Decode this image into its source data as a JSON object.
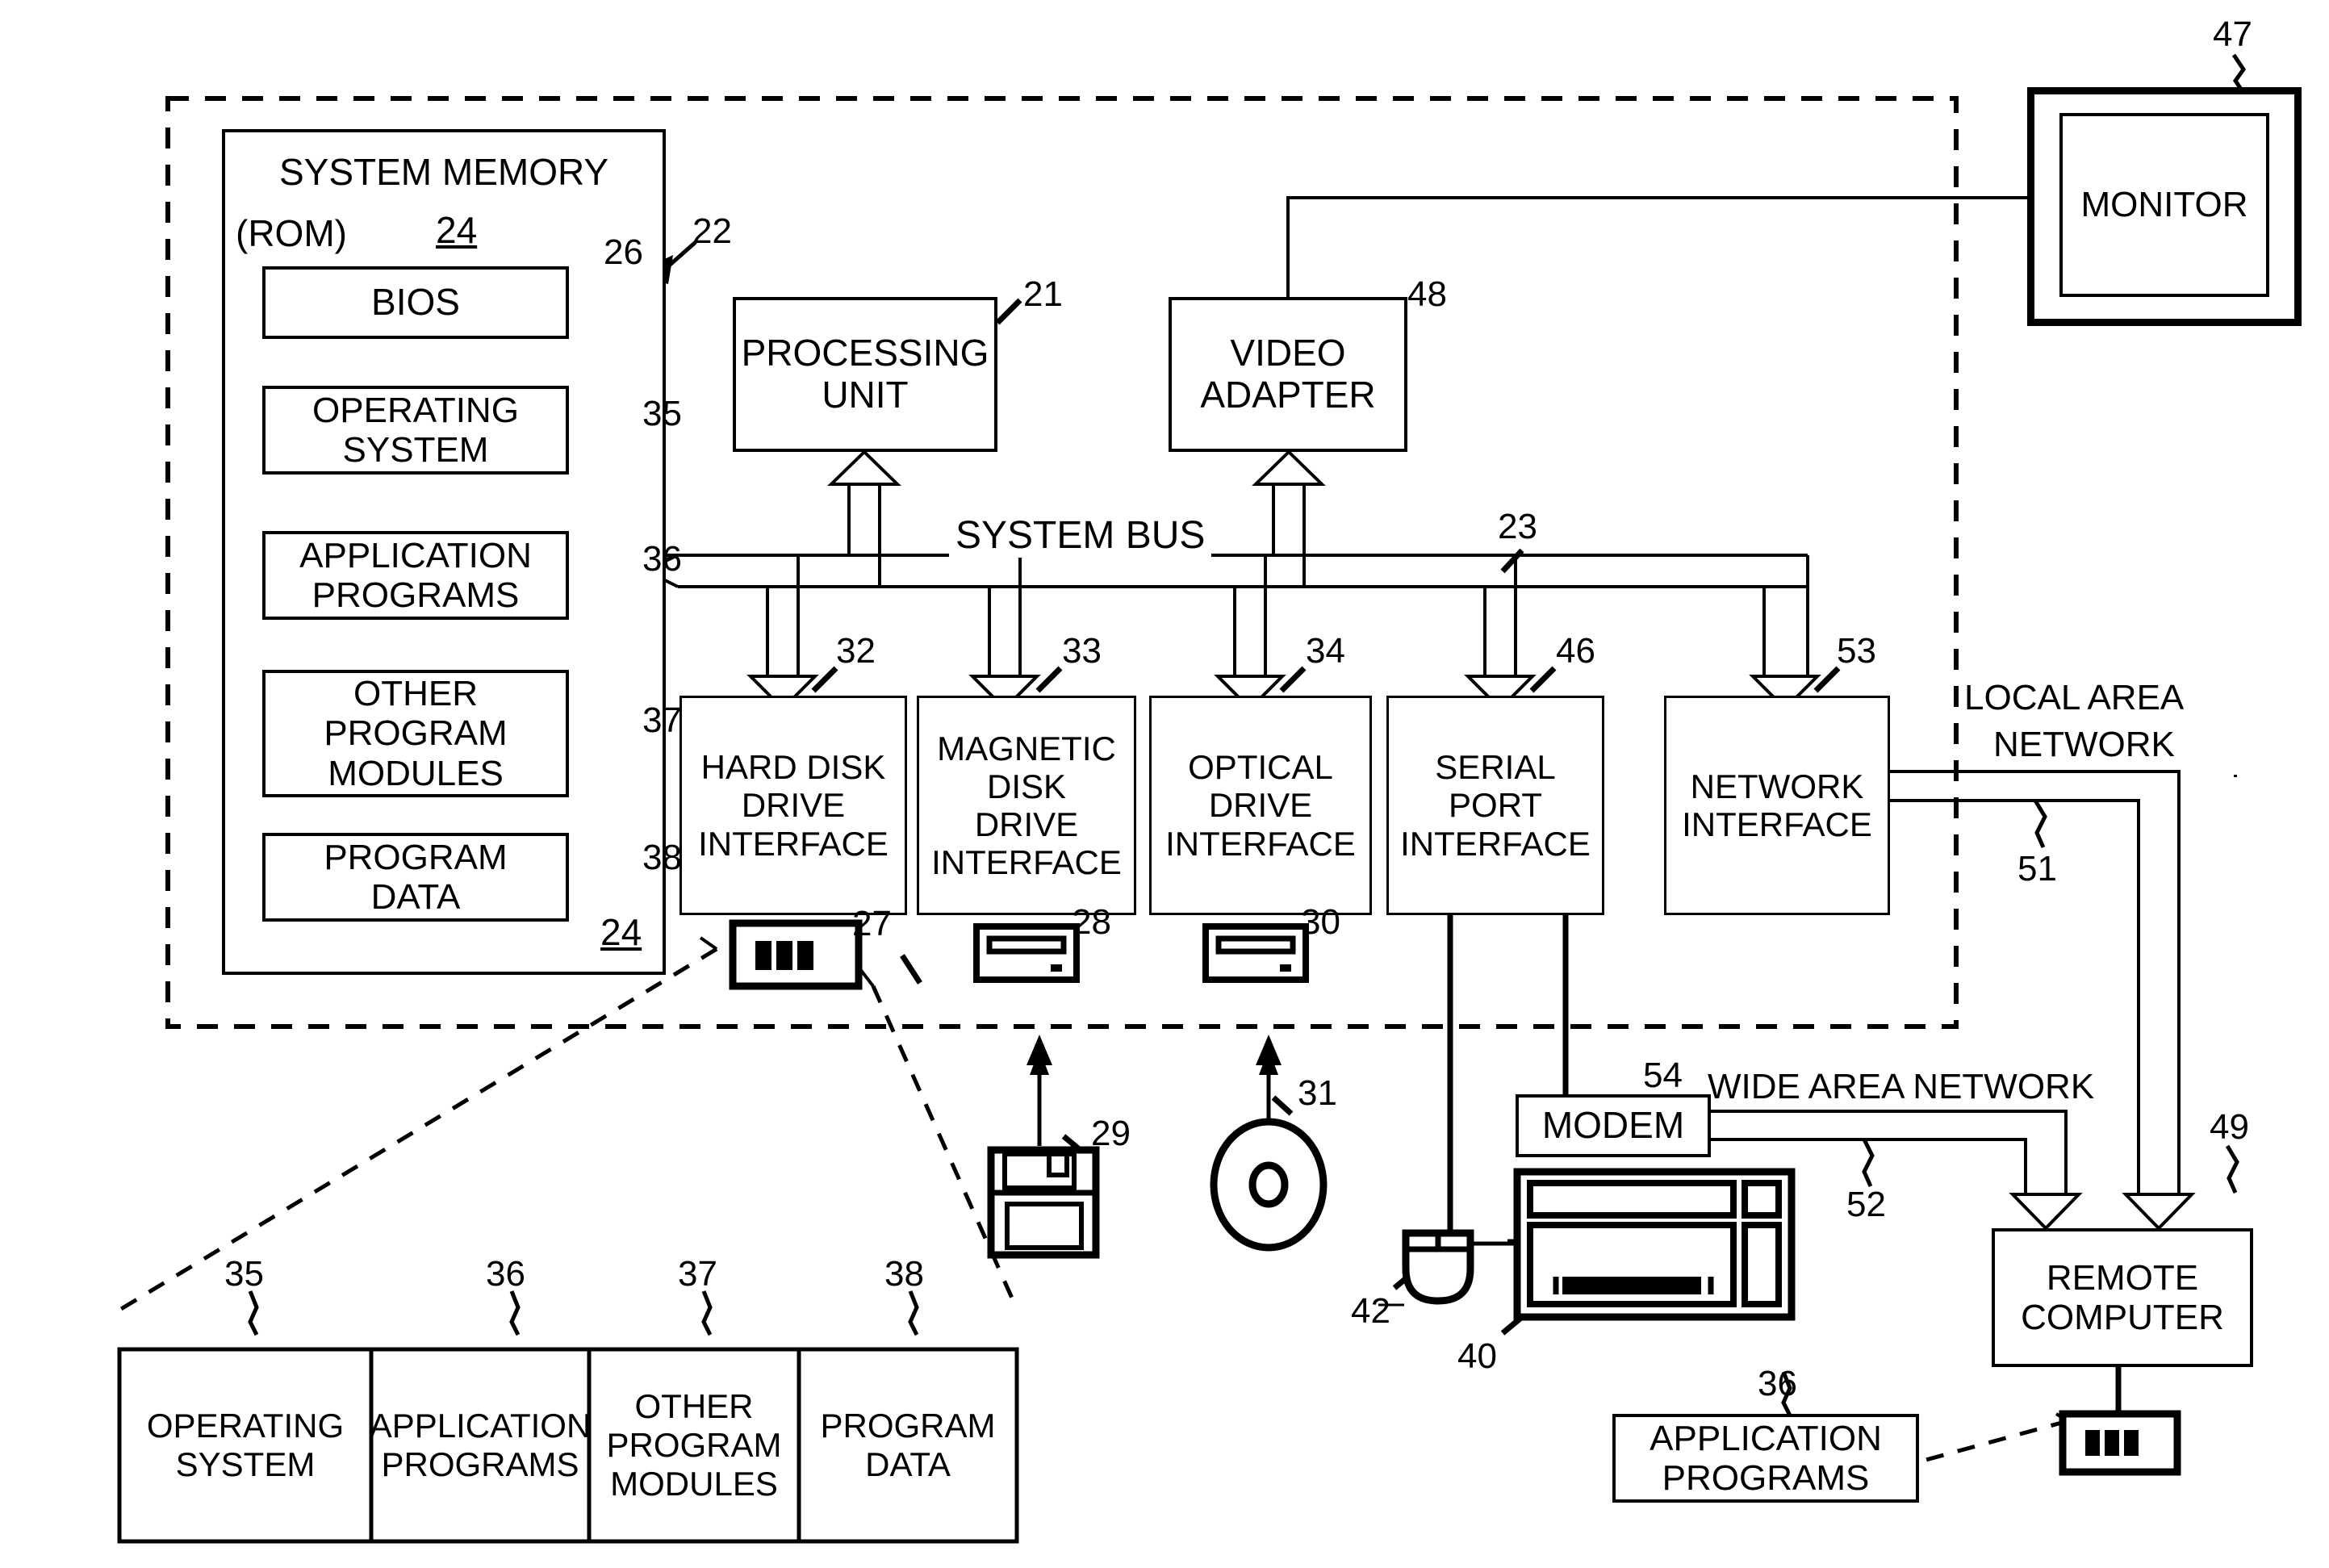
{
  "figure": {
    "title": "Computer system block diagram",
    "system_memory_label": "SYSTEM MEMORY",
    "rom_label": "(ROM)",
    "system_bus_label": "SYSTEM BUS",
    "lan_label_line1": "LOCAL AREA",
    "lan_label_line2": "NETWORK",
    "wan_label": "WIDE AREA NETWORK"
  },
  "memory": {
    "ref_top": "24",
    "ref_bottom": "24",
    "bios": {
      "label": "BIOS",
      "ref": "26"
    },
    "items": [
      {
        "line1": "OPERATING",
        "line2": "SYSTEM",
        "line3": "",
        "ref": "35"
      },
      {
        "line1": "APPLICATION",
        "line2": "PROGRAMS",
        "line3": "",
        "ref": "36"
      },
      {
        "line1": "OTHER",
        "line2": "PROGRAM",
        "line3": "MODULES",
        "ref": "37"
      },
      {
        "line1": "PROGRAM",
        "line2": "DATA",
        "line3": "",
        "ref": "38"
      }
    ]
  },
  "core": {
    "computer_ref": "22",
    "bus_ref": "23",
    "processing_unit": {
      "line1": "PROCESSING",
      "line2": "UNIT",
      "ref": "21"
    },
    "video_adapter": {
      "line1": "VIDEO",
      "line2": "ADAPTER",
      "ref": "48"
    },
    "monitor": {
      "label": "MONITOR",
      "ref": "47"
    }
  },
  "interfaces": [
    {
      "line1": "HARD DISK",
      "line2": "DRIVE",
      "line3": "INTERFACE",
      "ref": "32"
    },
    {
      "line1": "MAGNETIC",
      "line2": "DISK",
      "line3": "DRIVE",
      "line4": "INTERFACE",
      "ref": "33"
    },
    {
      "line1": "OPTICAL",
      "line2": "DRIVE",
      "line3": "INTERFACE",
      "ref": "34"
    },
    {
      "line1": "SERIAL",
      "line2": "PORT",
      "line3": "INTERFACE",
      "ref": "46"
    },
    {
      "line1": "NETWORK",
      "line2": "INTERFACE",
      "ref": "53"
    }
  ],
  "drives": {
    "hard_disk_ref": "27",
    "magnetic_drive_ref": "28",
    "optical_drive_ref": "30",
    "floppy_disk_ref": "29",
    "optical_disc_ref": "31"
  },
  "peripherals": {
    "mouse_ref": "42",
    "keyboard_ref": "40"
  },
  "network": {
    "lan_ref": "51",
    "wan_ref": "52",
    "modem": {
      "label": "MODEM",
      "ref": "54"
    },
    "remote_computer": {
      "line1": "REMOTE",
      "line2": "COMPUTER",
      "ref": "49"
    },
    "remote_apps": {
      "line1": "APPLICATION",
      "line2": "PROGRAMS",
      "ref": "36"
    }
  },
  "exploded_memory": {
    "cells": [
      {
        "line1": "OPERATING",
        "line2": "SYSTEM",
        "line3": "",
        "ref": "35"
      },
      {
        "line1": "APPLICATION",
        "line2": "PROGRAMS",
        "line3": "",
        "ref": "36"
      },
      {
        "line1": "OTHER",
        "line2": "PROGRAM",
        "line3": "MODULES",
        "ref": "37"
      },
      {
        "line1": "PROGRAM",
        "line2": "DATA",
        "line3": "",
        "ref": "38"
      }
    ]
  }
}
